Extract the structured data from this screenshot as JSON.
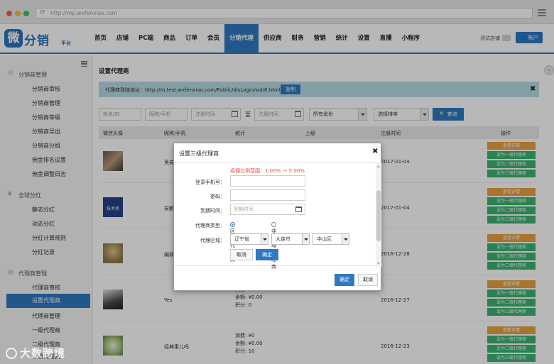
{
  "browser": {
    "url": "http://mp.wxfenxiao.com",
    "traffic_lights": [
      "#f25f58",
      "#fbbe3b",
      "#3fc74a"
    ]
  },
  "brand": {
    "mark": "微",
    "name": "分销",
    "sub": "平台",
    "color": "#2b73bd"
  },
  "nav": {
    "items": [
      "首页",
      "店铺",
      "PC端",
      "商品",
      "订单",
      "会员",
      "分销代理",
      "供应商",
      "财务",
      "营销",
      "统计",
      "设置",
      "直播",
      "小程序"
    ],
    "active": "分销代理",
    "shop_label": "测试店铺",
    "account_label": "账户"
  },
  "sidebar": {
    "groups": [
      {
        "title": "分销商管理",
        "icon": "people-icon",
        "items": [
          "分销商审核",
          "分销商管理",
          "分销商等级",
          "分销商导出",
          "分销商分组",
          "佣金排名设置",
          "佣金调整日志"
        ]
      },
      {
        "title": "全球分红",
        "icon": "yen-icon",
        "items": [
          "静态分红",
          "动态分红",
          "分红计算规则",
          "分红记录"
        ]
      },
      {
        "title": "代理商管理",
        "icon": "agent-icon",
        "items": [
          "代理商审核",
          "设置代理商",
          "代理商管理",
          "一级代理商",
          "二级代理商",
          "三级代理商"
        ]
      }
    ],
    "active": "设置代理商"
  },
  "page": {
    "title": "设置代理商",
    "login_url_label": "代理商登陆地址：http://m.test.wxfenxiao.com/Public/disLogin/sid/6.html",
    "copy_label": "复制"
  },
  "filters": {
    "name_placeholder": "姓名/ID",
    "nick_placeholder": "昵称/手机",
    "start_placeholder": "注册时间",
    "to_label": "至",
    "end_placeholder": "注册时间",
    "province": "所有省份",
    "sort": "选择排序",
    "search_label": "查询"
  },
  "table": {
    "headers": [
      "微信头像",
      "昵称/手机",
      "统计",
      "上级",
      "注册时间",
      "操作"
    ],
    "ops": [
      "查看详情",
      "设为一级代理商",
      "设为二级代理商",
      "设为三级代理商"
    ],
    "rows": [
      {
        "nick": "英矣",
        "stats": [],
        "date": "2017-01-04",
        "avatar": "phone-photo"
      },
      {
        "nick": "安麟",
        "stats": [],
        "date": "2017-01-04",
        "avatar": "book-cover",
        "avatar_text": "技术男"
      },
      {
        "nick": "阑故",
        "stats": [],
        "date": "2016-12-28",
        "avatar": "hand-photo"
      },
      {
        "nick": "Yes",
        "stats": [
          "消费: ¥0",
          "余额: ¥0.00",
          "积分: 0"
        ],
        "date": "2016-12-27",
        "avatar": "dog-photo"
      },
      {
        "nick": "经典事儿吗",
        "stats": [
          "消费: ¥0",
          "余额: ¥0.00",
          "积分: 10"
        ],
        "date": "2016-12-23",
        "avatar": "flower-photo"
      }
    ]
  },
  "modal": {
    "title": "设置三级代理商",
    "hint": "返佣比例范围：1.00% ～ 5.00%",
    "phone_label": "登录手机号：",
    "password_label": "密码：",
    "expire_label": "到期时间：",
    "expire_placeholder": "到期时间",
    "type_label": "代理商类型：",
    "type_options": [
      "区域代理商",
      "非区域代理商"
    ],
    "region_label": "代理区域：",
    "province": "辽宁省",
    "city": "大连市",
    "district": "中山区",
    "inner_cancel": "取消",
    "inner_ok": "确定",
    "ok": "确定",
    "cancel": "取消"
  },
  "watermark": "大数跨境"
}
